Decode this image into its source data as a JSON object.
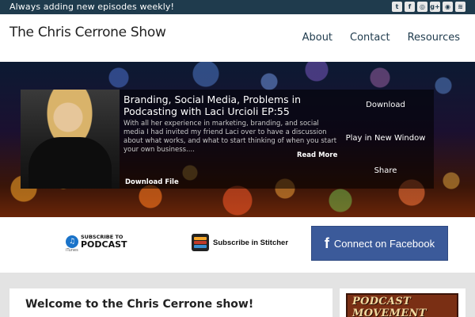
{
  "topbar": {
    "tagline": "Always adding new episodes weekly!",
    "social_icons": [
      {
        "name": "twitter-icon",
        "glyph": "t"
      },
      {
        "name": "facebook-icon",
        "glyph": "f"
      },
      {
        "name": "instagram-icon",
        "glyph": "◎"
      },
      {
        "name": "google-plus-icon",
        "glyph": "g+"
      },
      {
        "name": "podcast-icon",
        "glyph": "◉"
      },
      {
        "name": "rss-icon",
        "glyph": "≋"
      }
    ]
  },
  "header": {
    "site_title": "The Chris Cerrone Show",
    "nav": [
      "About",
      "Contact",
      "Resources"
    ]
  },
  "player": {
    "episode_title": "Branding, Social Media, Problems in Podcasting with Laci Urcioli EP:55",
    "description": "With all her experience in marketing, branding, and social media I had invited my friend Laci over to have a discussion about what works, and what to start thinking of when you start your own business....",
    "read_more": "Read More",
    "download_file": "Download File",
    "actions": {
      "download": "Download",
      "play_new_window": "Play in New Window",
      "share": "Share"
    }
  },
  "subscribe": {
    "itunes_line1": "SUBSCRIBE TO",
    "itunes_line2": "PODCAST",
    "itunes_line3": "iTunes",
    "stitcher_label": "Subscribe in Stitcher",
    "facebook_label": "Connect on Facebook"
  },
  "main": {
    "welcome_heading": "Welcome to the Chris Cerrone show!"
  },
  "sidebar": {
    "banner_text": "PODCAST MOVEMENT"
  },
  "colors": {
    "topbar": "#1f3b4d",
    "facebook": "#3b5a9a"
  }
}
